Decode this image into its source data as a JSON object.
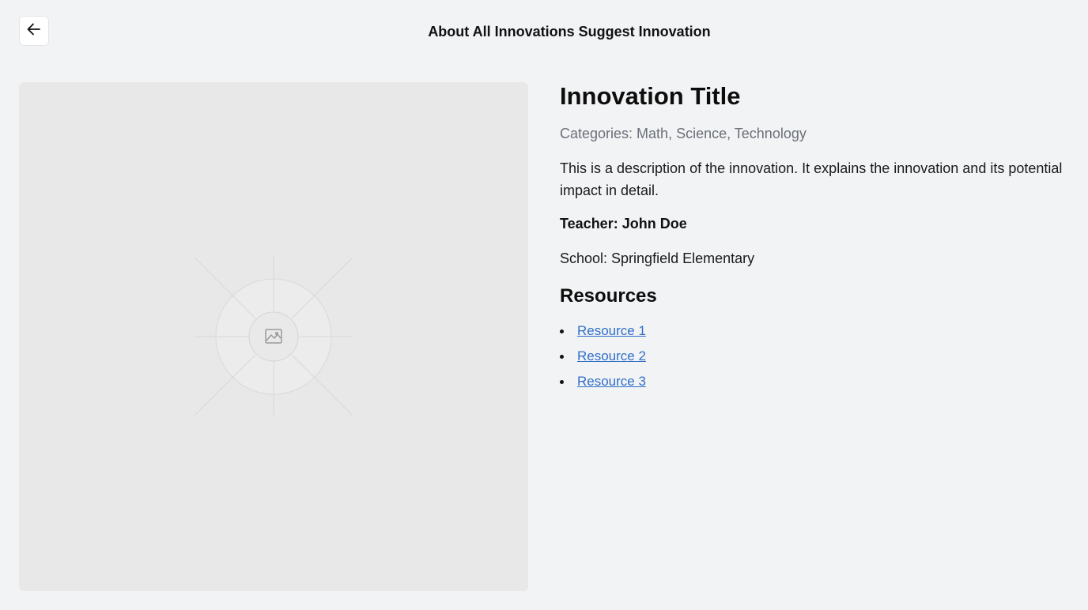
{
  "header": {
    "nav_links": [
      "About",
      "All Innovations",
      "Suggest Innovation"
    ]
  },
  "innovation": {
    "title": "Innovation Title",
    "categories": "Categories: Math, Science, Technology",
    "description": "This is a description of the innovation. It explains the innovation and its potential impact in detail.",
    "teacher": "Teacher: John Doe",
    "school": "School: Springfield Elementary"
  },
  "resources": {
    "heading": "Resources",
    "items": [
      "Resource 1",
      "Resource 2",
      "Resource 3"
    ]
  },
  "icons": {
    "back": "arrow-left-icon",
    "placeholder": "image-icon"
  },
  "colors": {
    "background": "#f2f3f5",
    "link": "#2f6fc9",
    "muted": "#6b7078",
    "placeholder_bg": "#e8e8e9"
  }
}
